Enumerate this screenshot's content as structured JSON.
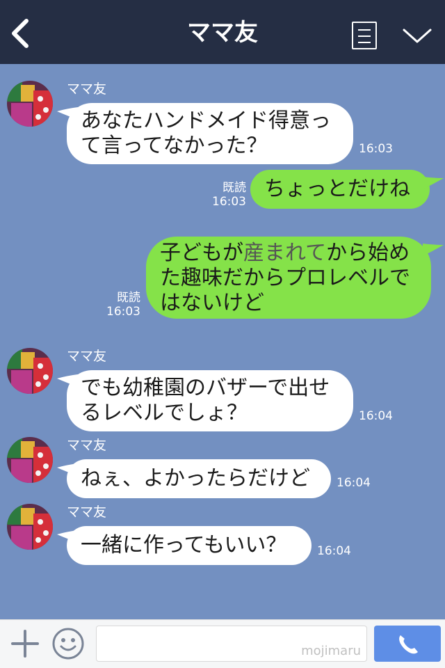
{
  "header": {
    "title": "ママ友"
  },
  "messages": {
    "m1": {
      "sender": "ママ友",
      "line1": "あなたハンドメイド得意っ",
      "line2": "て言ってなかった？",
      "time": "16:03"
    },
    "m2": {
      "text": "ちょっとだけね",
      "read": "既読",
      "time": "16:03"
    },
    "m3": {
      "line1_a": "子どもが",
      "line1_b": "産まれて",
      "line1_c": "から始め",
      "line2": "た趣味だからプロレベルで",
      "line3": "はないけど",
      "read": "既読",
      "time": "16:03"
    },
    "m4": {
      "sender": "ママ友",
      "line1": "でも幼稚園のバザーで出せ",
      "line2": "るレベルでしょ？",
      "time": "16:04"
    },
    "m5": {
      "sender": "ママ友",
      "text": "ねぇ、よかったらだけど",
      "time": "16:04"
    },
    "m6": {
      "sender": "ママ友",
      "text": "一緒に作ってもいい？",
      "time": "16:04"
    }
  },
  "footer": {
    "watermark": "mojimaru"
  },
  "colors": {
    "header": "#252e44",
    "background": "#7390c1",
    "bubble_out": "#85e249",
    "bubble_in": "#ffffff",
    "call_button": "#5e8ee6"
  },
  "icons": {
    "back": "chevron-left-icon",
    "menu": "menu-icon",
    "collapse": "chevron-down-icon",
    "plus": "plus-icon",
    "emoji": "smiley-icon",
    "call": "phone-icon"
  }
}
